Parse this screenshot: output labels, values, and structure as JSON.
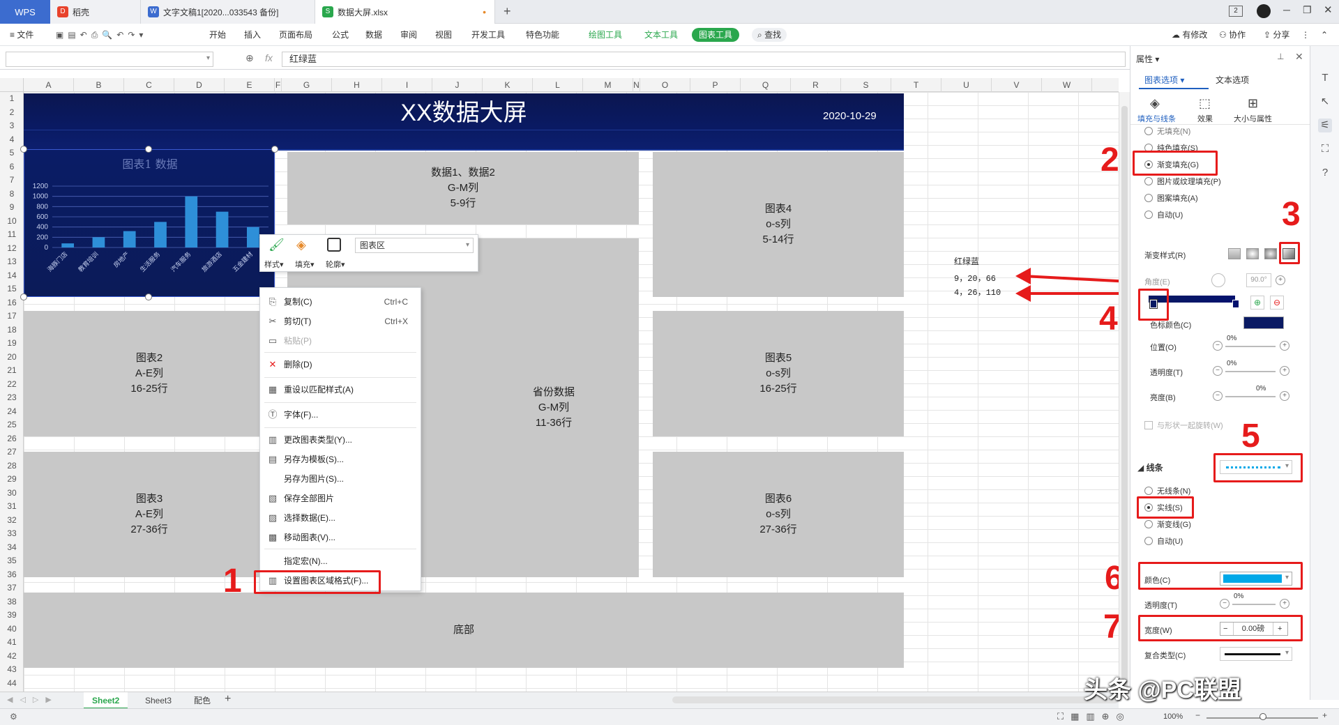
{
  "tabs": {
    "wps": "WPS",
    "items": [
      {
        "label": "稻壳"
      },
      {
        "label": "文字文稿1[2020...033543 备份]"
      },
      {
        "label": "数据大屏.xlsx"
      }
    ]
  },
  "menu": {
    "file": "文件",
    "items": [
      "开始",
      "插入",
      "页面布局",
      "公式",
      "数据",
      "审阅",
      "视图",
      "开发工具",
      "特色功能"
    ],
    "draw_tool": "绘图工具",
    "text_tool": "文本工具",
    "chart_tool": "图表工具",
    "search": "查找",
    "right": [
      "有修改",
      "协作",
      "分享"
    ]
  },
  "formula": {
    "fx": "fx",
    "value": "红绿蓝"
  },
  "columns": [
    "A",
    "B",
    "C",
    "D",
    "E",
    "F",
    "G",
    "H",
    "I",
    "J",
    "K",
    "L",
    "M",
    "N",
    "O",
    "P",
    "Q",
    "R",
    "S",
    "T",
    "U",
    "V",
    "W"
  ],
  "rows": [
    "1",
    "2",
    "3",
    "4",
    "5",
    "6",
    "7",
    "8",
    "9",
    "10",
    "11",
    "12",
    "13",
    "14",
    "15",
    "16",
    "17",
    "18",
    "19",
    "20",
    "21",
    "22",
    "23",
    "24",
    "25",
    "26",
    "27",
    "28",
    "29",
    "30",
    "31",
    "32",
    "33",
    "34",
    "35",
    "36",
    "37",
    "38",
    "39",
    "40",
    "41",
    "42",
    "43",
    "44"
  ],
  "banner": {
    "title": "XX数据大屏",
    "date": "2020-10-29"
  },
  "chart_data": {
    "type": "bar",
    "title": "图表1 数据",
    "categories": [
      "海豚门店",
      "教育培训",
      "房地产",
      "生活服务",
      "汽车服务",
      "旅游酒店",
      "五金建材"
    ],
    "values": [
      80,
      200,
      320,
      500,
      1000,
      700,
      400
    ],
    "ylim": [
      0,
      1200
    ],
    "yticks": [
      "1200",
      "1000",
      "800",
      "600",
      "400",
      "200",
      "0"
    ]
  },
  "blocks": {
    "b1": [
      "数据1、数据2",
      "G-M列",
      "5-9行"
    ],
    "b4": [
      "图表4",
      "o-s列",
      "5-14行"
    ],
    "b2": [
      "图表2",
      "A-E列",
      "16-25行"
    ],
    "bprov": [
      "省份数据",
      "G-M列",
      "11-36行"
    ],
    "b5": [
      "图表5",
      "o-s列",
      "16-25行"
    ],
    "b3": [
      "图表3",
      "A-E列",
      "27-36行"
    ],
    "b6": [
      "图表6",
      "o-s列",
      "27-36行"
    ],
    "bottom": [
      "底部"
    ]
  },
  "cells": {
    "label": "红绿蓝",
    "rgb1": "9，20，66",
    "rgb2": "4，26，110"
  },
  "mini": {
    "style": "样式",
    "fill": "填充",
    "outline": "轮廓",
    "area": "图表区"
  },
  "ctx": [
    {
      "label": "复制(C)",
      "shortcut": "Ctrl+C",
      "icon": "⎘"
    },
    {
      "label": "剪切(T)",
      "shortcut": "Ctrl+X",
      "icon": "✂"
    },
    {
      "label": "粘贴(P)",
      "shortcut": "",
      "icon": "▭"
    },
    {
      "label": "删除(D)",
      "shortcut": "",
      "icon": "✕"
    },
    {
      "label": "重设以匹配样式(A)",
      "shortcut": "",
      "icon": "▦"
    },
    {
      "label": "字体(F)...",
      "shortcut": "",
      "icon": "Ⓣ"
    },
    {
      "label": "更改图表类型(Y)...",
      "shortcut": "",
      "icon": "▥"
    },
    {
      "label": "另存为模板(S)...",
      "shortcut": "",
      "icon": "▤"
    },
    {
      "label": "另存为图片(S)...",
      "shortcut": "",
      "icon": ""
    },
    {
      "label": "保存全部图片",
      "shortcut": "",
      "icon": "▧"
    },
    {
      "label": "选择数据(E)...",
      "shortcut": "",
      "icon": "▨"
    },
    {
      "label": "移动图表(V)...",
      "shortcut": "",
      "icon": "▩"
    },
    {
      "label": "指定宏(N)...",
      "shortcut": "",
      "icon": ""
    },
    {
      "label": "设置图表区域格式(F)...",
      "shortcut": "",
      "icon": "▥"
    }
  ],
  "panel": {
    "title": "属性",
    "tab_chart": "图表选项",
    "tab_text": "文本选项",
    "sub_fill": "填充与线条",
    "sub_effect": "效果",
    "sub_size": "大小与属性",
    "fill_opts": [
      "无填充(N)",
      "纯色填充(S)",
      "渐变填充(G)",
      "图片或纹理填充(P)",
      "图案填充(A)",
      "自动(U)"
    ],
    "grad_style": "渐变样式(R)",
    "angle": "角度(E)",
    "angle_val": "90.0°",
    "stop_color": "色标颜色(C)",
    "position": "位置(O)",
    "position_val": "0%",
    "transparency": "透明度(T)",
    "transparency_val": "0%",
    "brightness": "亮度(B)",
    "brightness_val": "0%",
    "rotate_with": "与形状一起旋转(W)",
    "line_section": "线条",
    "line_opts": [
      "无线条(N)",
      "实线(S)",
      "渐变线(G)",
      "自动(U)"
    ],
    "color": "颜色(C)",
    "line_transparency": "透明度(T)",
    "line_transparency_val": "0%",
    "width": "宽度(W)",
    "width_val": "0.00磅",
    "compound": "复合类型(C)"
  },
  "sheets": [
    "Sheet2",
    "Sheet3",
    "配色"
  ],
  "status": {
    "zoom": "100%"
  },
  "annotations": [
    "1",
    "2",
    "3",
    "4",
    "5",
    "6",
    "7"
  ],
  "watermark": "头条 @PC联盟",
  "colors": {
    "navy": "#0a1a63",
    "accent": "#00a8e8",
    "red": "#e61b1b",
    "green": "#2aa74d"
  }
}
